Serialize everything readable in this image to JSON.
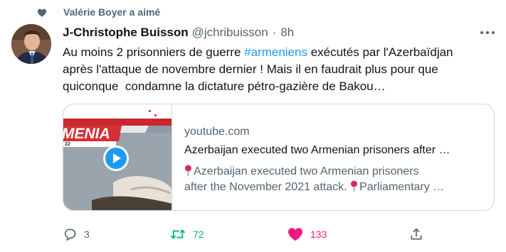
{
  "social_context": {
    "text": "Valérie Boyer a aimé"
  },
  "tweet": {
    "author_name": "J-Christophe Buisson",
    "handle": "@jchribuisson",
    "separator": "·",
    "time": "8h",
    "text_lines": [
      {
        "before": "Au moins 2 prisonniers de guerre ",
        "hashtag": "#armeniens",
        "after": " exécutés par l'Azerbaïdjan"
      },
      {
        "text": "après l'attaque de novembre dernier ! Mais il en faudrait plus pour que"
      },
      {
        "text": "quiconque  condamne la dictature pétro-gazière de Bakou…"
      }
    ]
  },
  "card": {
    "thumbnail_caption": "MENIA",
    "thumbnail_subcaption": "22",
    "domain": "youtube.com",
    "title": "Azerbaijan executed two Armenian prisoners after …",
    "description_line1": "Azerbaijan executed two Armenian prisoners",
    "description_line2": "after the November 2021 attack.",
    "description_line2_tail": "Parliamentary …"
  },
  "actions": {
    "reply_count": "3",
    "retweet_count": "72",
    "like_count": "133"
  },
  "colors": {
    "accent": "#1d9bf0",
    "retweet": "#00ba7c",
    "like": "#f91880",
    "secondary_text": "#536471",
    "primary_text": "#0f1419",
    "border": "#cfd9de"
  },
  "icons": [
    "heart-icon",
    "more-icon",
    "play-icon",
    "pin-icon",
    "reply-icon",
    "retweet-icon",
    "like-icon",
    "share-icon"
  ]
}
